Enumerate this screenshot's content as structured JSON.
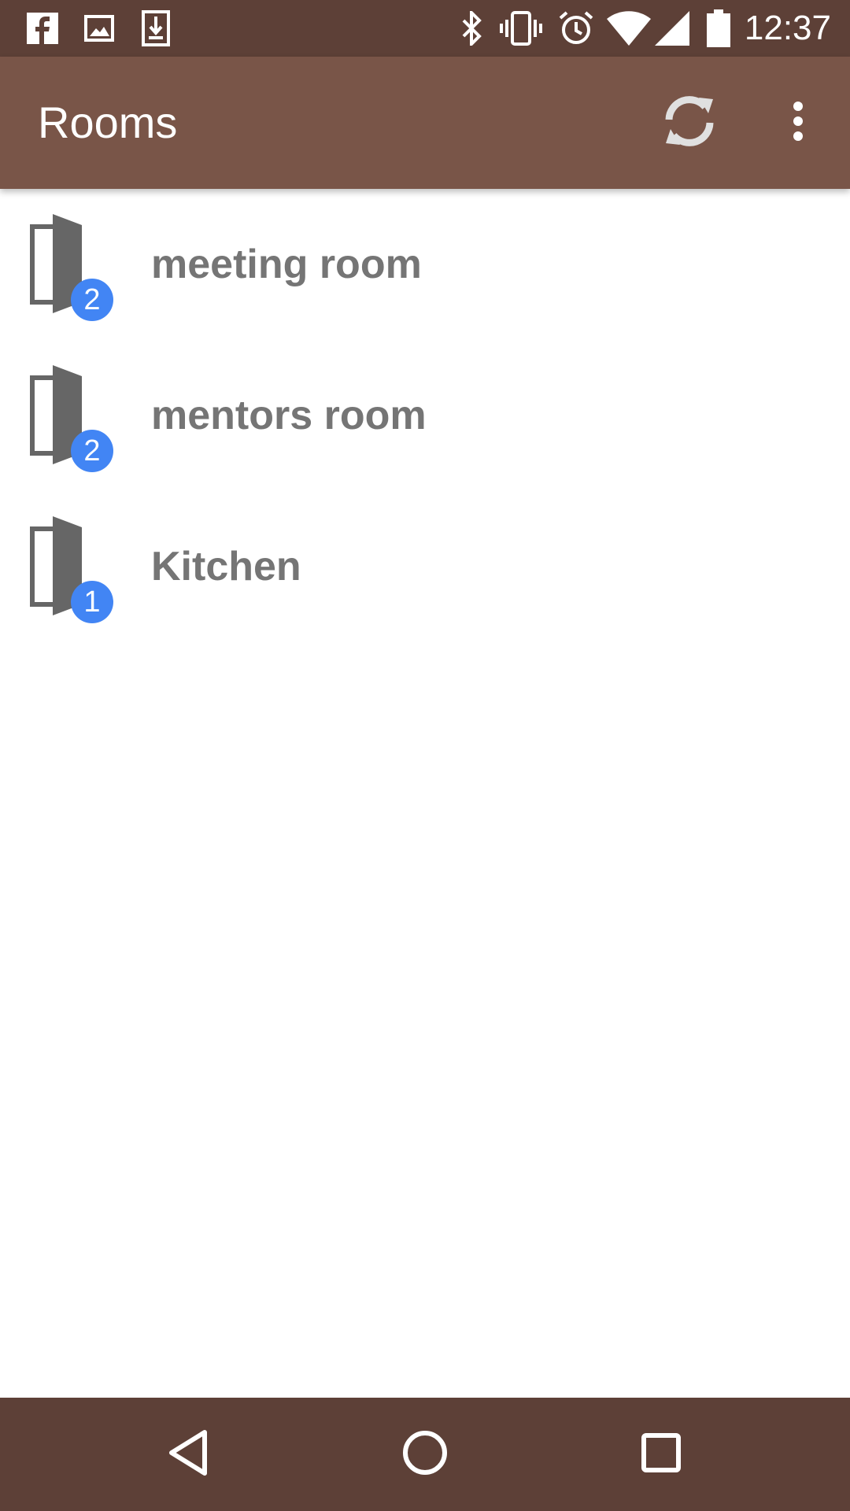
{
  "status_bar": {
    "time": "12:37",
    "left_icons": [
      "facebook-icon",
      "image-icon",
      "download-icon"
    ],
    "right_icons": [
      "bluetooth-icon",
      "vibrate-icon",
      "alarm-icon",
      "wifi-icon",
      "signal-icon",
      "battery-icon"
    ]
  },
  "app_bar": {
    "title": "Rooms",
    "actions": [
      "refresh-icon",
      "more-vert-icon"
    ]
  },
  "rooms": [
    {
      "name": "meeting room",
      "count": "2"
    },
    {
      "name": "mentors room",
      "count": "2"
    },
    {
      "name": "Kitchen",
      "count": "1"
    }
  ],
  "nav_bar": {
    "buttons": [
      "back-icon",
      "home-icon",
      "recents-icon"
    ]
  },
  "colors": {
    "status_bar": "#5d4037",
    "app_bar": "#795548",
    "badge": "#4285f4",
    "room_text": "#757575",
    "door_icon": "#666666"
  }
}
